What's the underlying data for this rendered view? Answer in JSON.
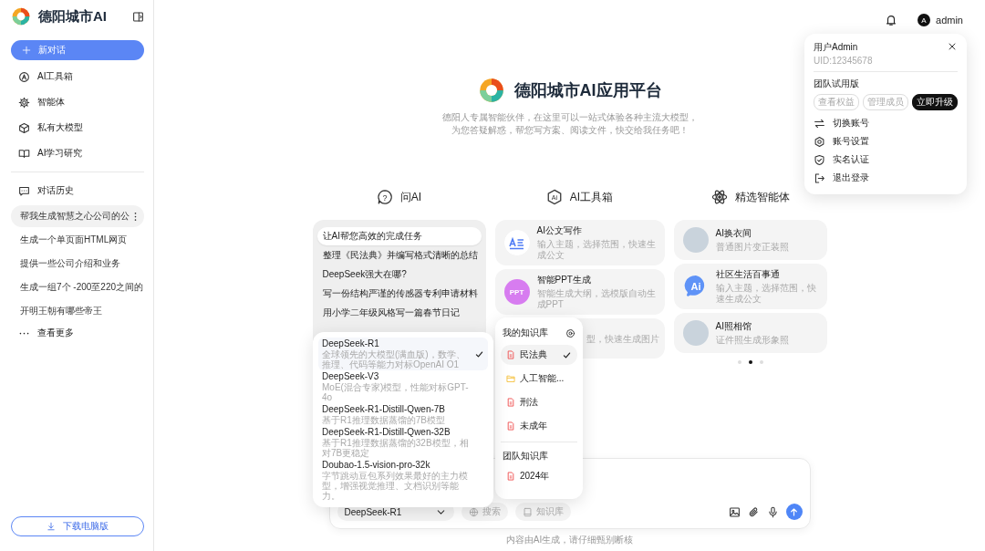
{
  "sidebar": {
    "brand": "德阳城市AI",
    "new_chat": "新对话",
    "nav": [
      {
        "label": "AI工具箱",
        "kind": "badge"
      },
      {
        "label": "智能体",
        "kind": "gear"
      },
      {
        "label": "私有大模型",
        "kind": "cube"
      },
      {
        "label": "AI学习研究",
        "kind": "book"
      }
    ],
    "history_title": "对话历史",
    "history": [
      {
        "title": "帮我生成智慧之心公司的公",
        "selected": true
      },
      {
        "title": "生成一个单页面HTML网页",
        "selected": false
      },
      {
        "title": "提供一些公司介绍和业务",
        "selected": false
      },
      {
        "title": "生成一组7个 -200至220之间的",
        "selected": false
      },
      {
        "title": "开明王朝有哪些帝王",
        "selected": false
      }
    ],
    "more": "查看更多",
    "download": "下载电脑版"
  },
  "topbar": {
    "user": "admin",
    "avatar": "A"
  },
  "user_menu": {
    "name": "用户Admin",
    "uid": "UID:12345678",
    "plan": "团队试用版",
    "tags": [
      {
        "label": "查看权益",
        "kind": "outline"
      },
      {
        "label": "管理成员",
        "kind": "outline"
      },
      {
        "label": "立即升级",
        "kind": "filled"
      }
    ],
    "items": [
      {
        "label": "切换账号",
        "kind": "switch"
      },
      {
        "label": "账号设置",
        "kind": "settings"
      },
      {
        "label": "实名认证",
        "kind": "shield"
      },
      {
        "label": "退出登录",
        "kind": "logout"
      }
    ]
  },
  "hero": {
    "title": "德阳城市AI应用平台",
    "subtitle": [
      "德阳人专属智能伙伴，在这里可以一站式体验各种主流大模型，",
      "为您答疑解惑，帮您写方案、阅读文件，快交给我任务吧！"
    ]
  },
  "sections": [
    {
      "title": "问AI",
      "kind": "ask",
      "icon_text": "?"
    },
    {
      "title": "AI工具箱",
      "kind": "tools",
      "icon_text": "Ai"
    },
    {
      "title": "精选智能体",
      "kind": "agents"
    }
  ],
  "questions": [
    {
      "text": "让AI帮您高效的完成任务",
      "selected": true
    },
    {
      "text": "整理《民法典》并编写格式清晰的总结",
      "selected": false
    },
    {
      "text": "DeepSeek强大在哪?",
      "selected": false
    },
    {
      "text": "写一份结构严谨的传感器专利申请材料",
      "selected": false
    },
    {
      "text": "用小学二年级风格写一篇春节日记",
      "selected": false
    }
  ],
  "tools": [
    {
      "title": "AI公文写作",
      "desc": "输入主题，选择范围，快速生成公文",
      "kind": "doc"
    },
    {
      "title": "智能PPT生成",
      "desc": "智能生成大纲，选模版自动生成PPT",
      "kind": "ppt",
      "badge": "PPT"
    },
    {
      "desc": "型，快速生成图片",
      "kind": "covered"
    }
  ],
  "agents": [
    {
      "title": "AI换衣间",
      "desc": "普通图片变正装照",
      "kind": "photo"
    },
    {
      "title": "社区生活百事通",
      "desc": "输入主题，选择范围，快速生成公文",
      "kind": "bubble",
      "icon_text": "Ai"
    },
    {
      "title": "AI照相馆",
      "desc": "证件照生成形象照",
      "kind": "photo"
    }
  ],
  "pager": [
    {
      "selected": false
    },
    {
      "selected": true
    },
    {
      "selected": false
    }
  ],
  "model_menu": [
    {
      "name": "DeepSeek-R1",
      "desc": "全球领先的大模型(满血版)，数学、推理、代码等能力对标OpenAI O1",
      "selected": true
    },
    {
      "name": "DeepSeek-V3",
      "desc": "MoE(混合专家)模型，性能对标GPT-4o",
      "selected": false
    },
    {
      "name": "DeepSeek-R1-Distill-Qwen-7B",
      "desc": "基于R1推理数据蒸馏的7B模型",
      "selected": false
    },
    {
      "name": "DeepSeek-R1-Distill-Qwen-32B",
      "desc": "基于R1推理数据蒸馏的32B模型，相对7B更稳定",
      "selected": false
    },
    {
      "name": "Doubao-1.5-vision-pro-32k",
      "desc": "字节跳动豆包系列效果最好的主力模型，增强视觉推理、文档识别等能力。",
      "selected": false
    }
  ],
  "knowledge": {
    "title": "我的知识库",
    "items": [
      {
        "label": "民法典",
        "kind": "file",
        "selected": true
      },
      {
        "label": "人工智能...",
        "kind": "folder",
        "selected": false
      },
      {
        "label": "刑法",
        "kind": "file",
        "selected": false
      },
      {
        "label": "未成年",
        "kind": "file",
        "selected": false
      }
    ],
    "team_title": "团队知识库",
    "team_items": [
      {
        "label": "2024年",
        "kind": "file",
        "selected": false
      }
    ]
  },
  "composer": {
    "model": "DeepSeek-R1",
    "search": "搜索",
    "knowledge": "知识库"
  },
  "footer": "内容由AI生成，请仔细甄别断核"
}
